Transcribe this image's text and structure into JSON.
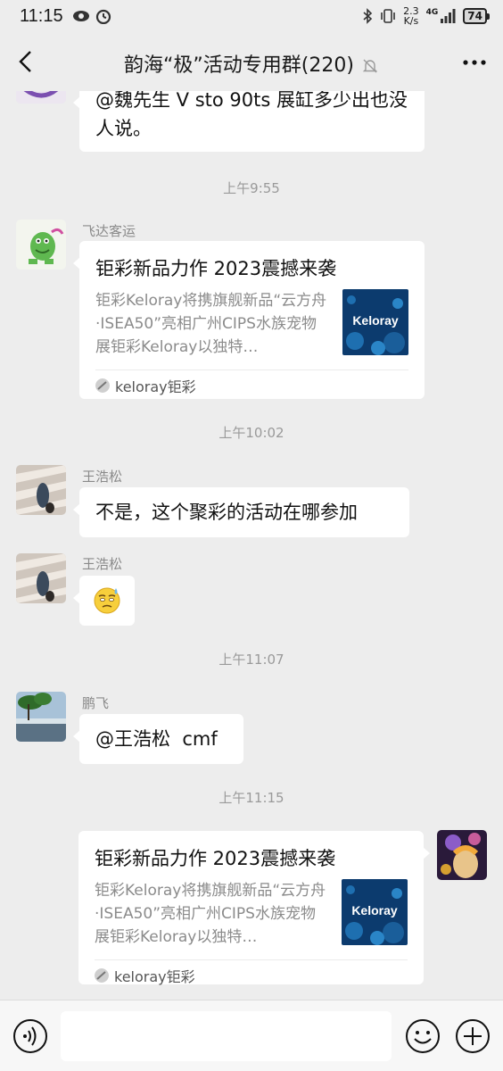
{
  "status_bar": {
    "time": "11:15",
    "net_speed_value": "2.3",
    "net_speed_unit": "K/s",
    "signal": "4G",
    "battery": "74"
  },
  "header": {
    "title": "韵海“极”活动专用群(220)"
  },
  "messages": [
    {
      "type": "text",
      "text": "@魏先生 V sto 90ts 展缸多少出也没人说。"
    },
    {
      "type": "time",
      "text": "上午9:55"
    },
    {
      "type": "card",
      "sender": "飞达客运",
      "title": "钜彩新品力作 2023震撼来袭",
      "desc": "钜彩Keloray将携旗舰新品“云方舟·ISEA50”亮相广州CIPS水族宠物展钜彩Keloray以独特…",
      "thumb_text": "Keloray",
      "source": "keloray钜彩"
    },
    {
      "type": "time",
      "text": "上午10:02"
    },
    {
      "type": "text",
      "sender": "王浩松",
      "text": "不是，这个聚彩的活动在哪参加"
    },
    {
      "type": "emoji",
      "sender": "王浩松",
      "emoji": "😓"
    },
    {
      "type": "time",
      "text": "上午11:07"
    },
    {
      "type": "text",
      "sender": "鹏飞",
      "text": "@王浩松  cmf"
    },
    {
      "type": "time",
      "text": "上午11:15"
    },
    {
      "type": "card",
      "self": true,
      "title": "钜彩新品力作 2023震撼来袭",
      "desc": "钜彩Keloray将携旗舰新品“云方舟·ISEA50”亮相广州CIPS水族宠物展钜彩Keloray以独特…",
      "thumb_text": "Keloray",
      "source": "keloray钜彩"
    }
  ],
  "colors": {
    "background": "#ededed",
    "bubble": "#ffffff",
    "timestamp": "#9a9a9a"
  }
}
